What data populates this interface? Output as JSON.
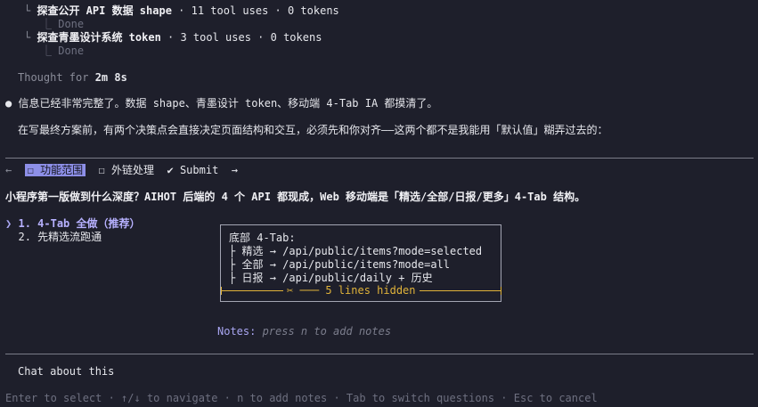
{
  "tasks": [
    {
      "title": "探查公开 API 数据 shape",
      "meta": " · 11 tool uses · 0 tokens",
      "status": "Done"
    },
    {
      "title": "探查青墨设计系统 token",
      "meta": " · 3 tool uses · 0 tokens",
      "status": "Done"
    }
  ],
  "thought": {
    "prefix": "Thought for ",
    "duration": "2m 8s"
  },
  "message": {
    "bullet": "●",
    "line1": "信息已经非常完整了。数据 shape、青墨设计 token、移动端 4-Tab IA 都摸清了。",
    "line2": "在写最终方案前，有两个决策点会直接决定页面结构和交互，必须先和你对齐——这两个都不是我能用「默认值」糊弄过去的："
  },
  "question_tabs": {
    "back": "←",
    "tabs": [
      {
        "label": "☐ 功能范围",
        "active": true
      },
      {
        "label": "☐ 外链处理",
        "active": false
      },
      {
        "label": "✔ Submit",
        "active": false
      }
    ],
    "forward": "→"
  },
  "question": "小程序第一版做到什么深度？AIHOT 后端的 4 个 API 都现成，Web 移动端是「精选/全部/日报/更多」4-Tab 结构。",
  "options": [
    {
      "pointer": "❯",
      "label": "1. 4-Tab 全做（推荐）",
      "selected": true
    },
    {
      "pointer": " ",
      "label": "2. 先精选流跑通",
      "selected": false
    }
  ],
  "preview": {
    "header": "底部 4-Tab:",
    "rows": [
      {
        "prefix": "├ ",
        "name": "精选",
        "arrow": " → ",
        "value": "/api/public/items?mode=selected"
      },
      {
        "prefix": "├ ",
        "name": "全部",
        "arrow": " → ",
        "value": "/api/public/items?mode=all"
      },
      {
        "prefix": "├ ",
        "name": "日报",
        "arrow": " → ",
        "value": "/api/public/daily + 历史"
      }
    ],
    "hidden": "✂ ─── 5 lines hidden"
  },
  "notes": {
    "label": "Notes:",
    "placeholder": " press n to add notes"
  },
  "chat": "Chat about this",
  "footer": "Enter to select · ↑/↓ to navigate · n to add notes · Tab to switch questions · Esc to cancel",
  "colors": {
    "background": "#1e1f2b",
    "accent": "#8d8fe8",
    "highlight": "#b7b1ff",
    "warning": "#e0b33a"
  }
}
